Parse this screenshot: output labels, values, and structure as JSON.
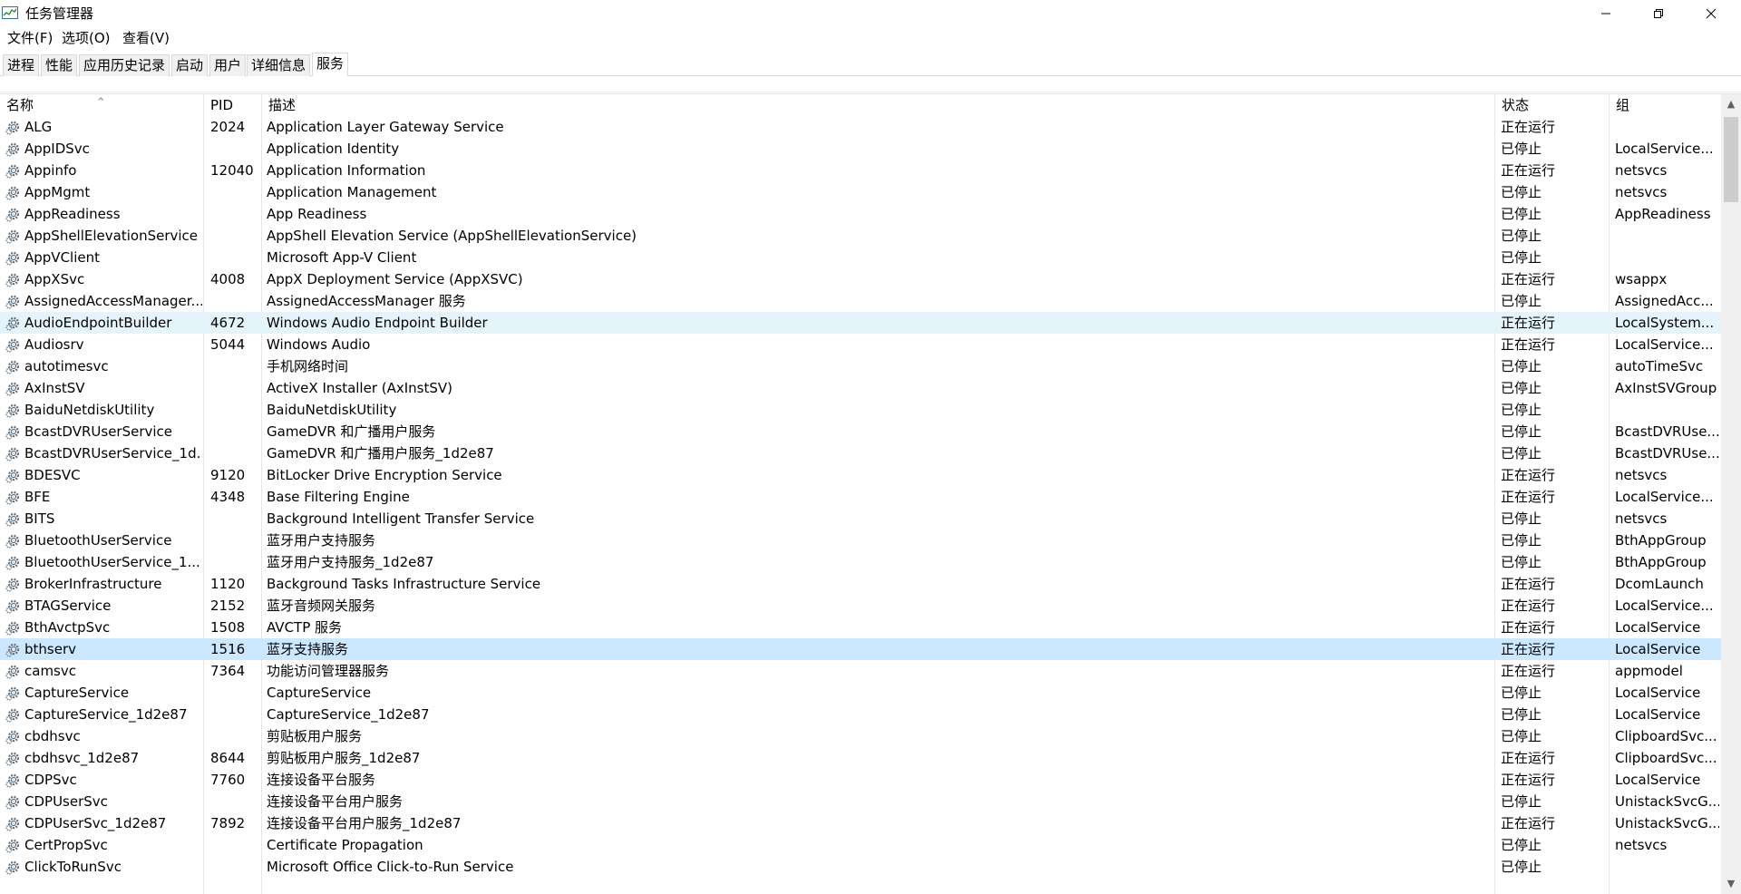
{
  "window": {
    "title": "任务管理器",
    "minimize_icon": "minimize-icon",
    "maximize_icon": "restore-icon",
    "close_icon": "close-icon"
  },
  "menu": {
    "file": "文件(F)",
    "options": "选项(O)",
    "view": "查看(V)"
  },
  "tabs": [
    "进程",
    "性能",
    "应用历史记录",
    "启动",
    "用户",
    "详细信息",
    "服务"
  ],
  "active_tab": "服务",
  "columns": {
    "name": "名称",
    "pid": "PID",
    "desc": "描述",
    "status": "状态",
    "group": "组"
  },
  "services": [
    {
      "name": "ALG",
      "pid": "2024",
      "desc": "Application Layer Gateway Service",
      "status": "正在运行",
      "group": ""
    },
    {
      "name": "AppIDSvc",
      "pid": "",
      "desc": "Application Identity",
      "status": "已停止",
      "group": "LocalService..."
    },
    {
      "name": "Appinfo",
      "pid": "12040",
      "desc": "Application Information",
      "status": "正在运行",
      "group": "netsvcs"
    },
    {
      "name": "AppMgmt",
      "pid": "",
      "desc": "Application Management",
      "status": "已停止",
      "group": "netsvcs"
    },
    {
      "name": "AppReadiness",
      "pid": "",
      "desc": "App Readiness",
      "status": "已停止",
      "group": "AppReadiness"
    },
    {
      "name": "AppShellElevationService",
      "pid": "",
      "desc": "AppShell Elevation Service (AppShellElevationService)",
      "status": "已停止",
      "group": ""
    },
    {
      "name": "AppVClient",
      "pid": "",
      "desc": "Microsoft App-V Client",
      "status": "已停止",
      "group": ""
    },
    {
      "name": "AppXSvc",
      "pid": "4008",
      "desc": "AppX Deployment Service (AppXSVC)",
      "status": "正在运行",
      "group": "wsappx"
    },
    {
      "name": "AssignedAccessManager...",
      "pid": "",
      "desc": "AssignedAccessManager 服务",
      "status": "已停止",
      "group": "AssignedAcc..."
    },
    {
      "name": "AudioEndpointBuilder",
      "pid": "4672",
      "desc": "Windows Audio Endpoint Builder",
      "status": "正在运行",
      "group": "LocalSystem..."
    },
    {
      "name": "Audiosrv",
      "pid": "5044",
      "desc": "Windows Audio",
      "status": "正在运行",
      "group": "LocalService..."
    },
    {
      "name": "autotimesvc",
      "pid": "",
      "desc": "手机网络时间",
      "status": "已停止",
      "group": "autoTimeSvc"
    },
    {
      "name": "AxInstSV",
      "pid": "",
      "desc": "ActiveX Installer (AxInstSV)",
      "status": "已停止",
      "group": "AxInstSVGroup"
    },
    {
      "name": "BaiduNetdiskUtility",
      "pid": "",
      "desc": "BaiduNetdiskUtility",
      "status": "已停止",
      "group": ""
    },
    {
      "name": "BcastDVRUserService",
      "pid": "",
      "desc": "GameDVR 和广播用户服务",
      "status": "已停止",
      "group": "BcastDVRUse..."
    },
    {
      "name": "BcastDVRUserService_1d...",
      "pid": "",
      "desc": "GameDVR 和广播用户服务_1d2e87",
      "status": "已停止",
      "group": "BcastDVRUse..."
    },
    {
      "name": "BDESVC",
      "pid": "9120",
      "desc": "BitLocker Drive Encryption Service",
      "status": "正在运行",
      "group": "netsvcs"
    },
    {
      "name": "BFE",
      "pid": "4348",
      "desc": "Base Filtering Engine",
      "status": "正在运行",
      "group": "LocalService..."
    },
    {
      "name": "BITS",
      "pid": "",
      "desc": "Background Intelligent Transfer Service",
      "status": "已停止",
      "group": "netsvcs"
    },
    {
      "name": "BluetoothUserService",
      "pid": "",
      "desc": "蓝牙用户支持服务",
      "status": "已停止",
      "group": "BthAppGroup"
    },
    {
      "name": "BluetoothUserService_1...",
      "pid": "",
      "desc": "蓝牙用户支持服务_1d2e87",
      "status": "已停止",
      "group": "BthAppGroup"
    },
    {
      "name": "BrokerInfrastructure",
      "pid": "1120",
      "desc": "Background Tasks Infrastructure Service",
      "status": "正在运行",
      "group": "DcomLaunch"
    },
    {
      "name": "BTAGService",
      "pid": "2152",
      "desc": "蓝牙音频网关服务",
      "status": "正在运行",
      "group": "LocalService..."
    },
    {
      "name": "BthAvctpSvc",
      "pid": "1508",
      "desc": "AVCTP 服务",
      "status": "正在运行",
      "group": "LocalService"
    },
    {
      "name": "bthserv",
      "pid": "1516",
      "desc": "蓝牙支持服务",
      "status": "正在运行",
      "group": "LocalService"
    },
    {
      "name": "camsvc",
      "pid": "7364",
      "desc": "功能访问管理器服务",
      "status": "正在运行",
      "group": "appmodel"
    },
    {
      "name": "CaptureService",
      "pid": "",
      "desc": "CaptureService",
      "status": "已停止",
      "group": "LocalService"
    },
    {
      "name": "CaptureService_1d2e87",
      "pid": "",
      "desc": "CaptureService_1d2e87",
      "status": "已停止",
      "group": "LocalService"
    },
    {
      "name": "cbdhsvc",
      "pid": "",
      "desc": "剪贴板用户服务",
      "status": "已停止",
      "group": "ClipboardSvc..."
    },
    {
      "name": "cbdhsvc_1d2e87",
      "pid": "8644",
      "desc": "剪贴板用户服务_1d2e87",
      "status": "正在运行",
      "group": "ClipboardSvc..."
    },
    {
      "name": "CDPSvc",
      "pid": "7760",
      "desc": "连接设备平台服务",
      "status": "正在运行",
      "group": "LocalService"
    },
    {
      "name": "CDPUserSvc",
      "pid": "",
      "desc": "连接设备平台用户服务",
      "status": "已停止",
      "group": "UnistackSvcG..."
    },
    {
      "name": "CDPUserSvc_1d2e87",
      "pid": "7892",
      "desc": "连接设备平台用户服务_1d2e87",
      "status": "正在运行",
      "group": "UnistackSvcG..."
    },
    {
      "name": "CertPropSvc",
      "pid": "",
      "desc": "Certificate Propagation",
      "status": "已停止",
      "group": "netsvcs"
    },
    {
      "name": "ClickToRunSvc",
      "pid": "",
      "desc": "Microsoft Office Click-to-Run Service",
      "status": "已停止",
      "group": ""
    }
  ],
  "hover_row": "AudioEndpointBuilder",
  "selected_row": "bthserv",
  "icons": {
    "service": "gear-icon",
    "sort": "sort-ascending-icon",
    "scroll_up": "scroll-up-icon",
    "scroll_down": "scroll-down-icon"
  },
  "colors": {
    "hover_row": "#e5f3fb",
    "selected_row": "#cce8ff",
    "grid_line": "#e5e5e5"
  }
}
